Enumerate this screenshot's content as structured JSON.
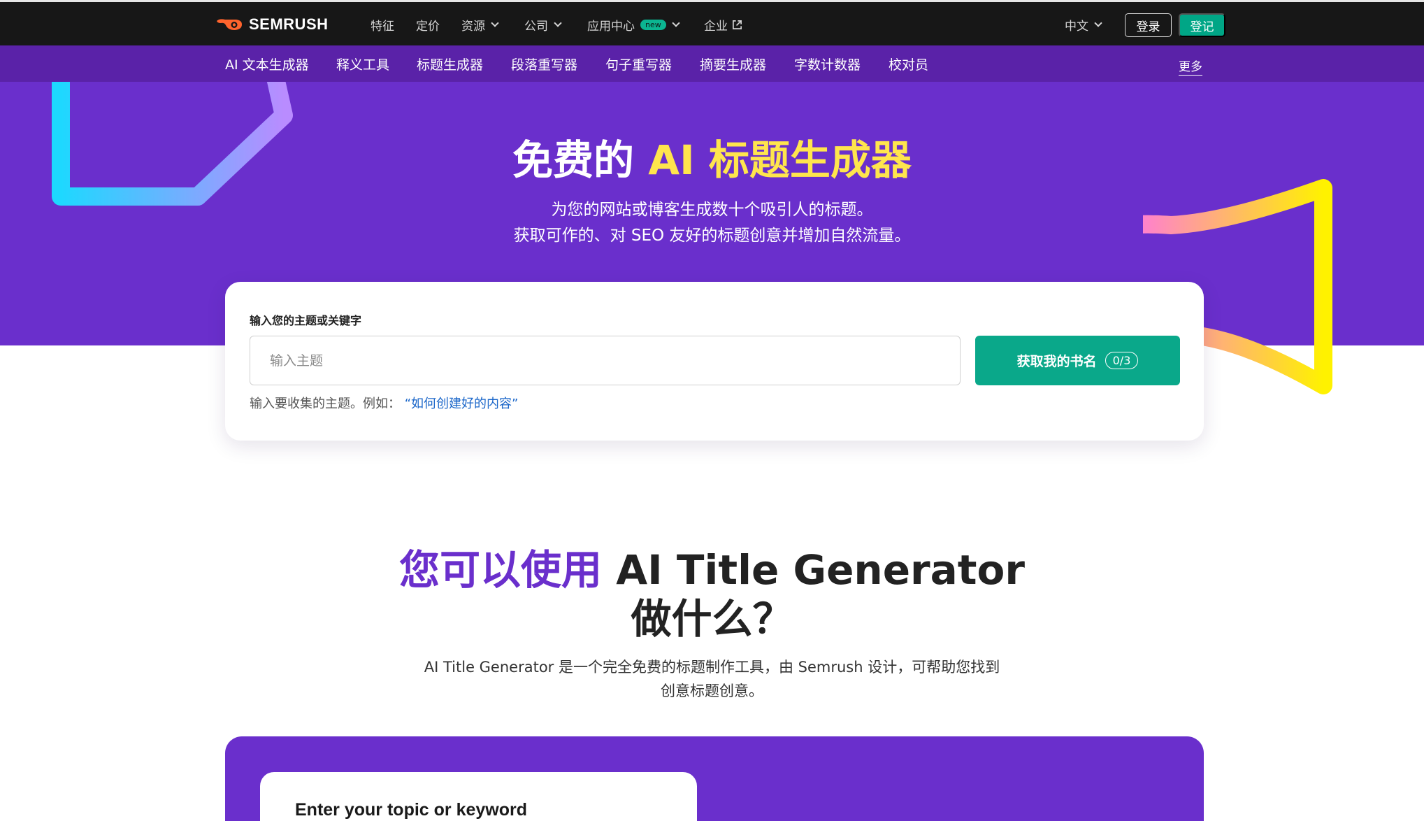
{
  "brand": {
    "name": "SEMRUSH"
  },
  "topnav": {
    "items": [
      {
        "label": "特征"
      },
      {
        "label": "定价"
      },
      {
        "label": "资源"
      },
      {
        "label": "公司"
      },
      {
        "label": "应用中心",
        "badge": "new"
      },
      {
        "label": "企业"
      }
    ],
    "language": "中文",
    "login_label": "登录",
    "signup_label": "登记"
  },
  "subnav": {
    "items": [
      {
        "label": "AI 文本生成器"
      },
      {
        "label": "释义工具"
      },
      {
        "label": "标题生成器"
      },
      {
        "label": "段落重写器"
      },
      {
        "label": "句子重写器"
      },
      {
        "label": "摘要生成器"
      },
      {
        "label": "字数计数器"
      },
      {
        "label": "校对员"
      }
    ],
    "more_label": "更多"
  },
  "hero": {
    "title_prefix": "免费的",
    "title_highlight": "AI 标题生成器",
    "subtitle_line1": "为您的网站或博客生成数十个吸引人的标题。",
    "subtitle_line2": "获取可作的、对 SEO 友好的标题创意并增加自然流量。"
  },
  "form": {
    "label": "输入您的主题或关键字",
    "placeholder": "输入主题",
    "button_label": "获取我的书名",
    "counter": "0/3",
    "hint_prefix": "输入要收集的主题。例如：",
    "hint_example": "“如何创建好的内容”"
  },
  "section": {
    "title_highlight": "您可以使用",
    "title_rest": "AI Title Generator",
    "title_line2": "做什么？",
    "desc_line1": "AI Title Generator 是一个完全免费的标题制作工具，由 Semrush 设计，可帮助您找到",
    "desc_line2": "创意标题创意。"
  },
  "feature": {
    "card_label": "Enter your topic or keyword"
  },
  "colors": {
    "topnav_bg": "#171717",
    "subnav_bg": "#5a22a8",
    "hero_bg": "#6a2fcc",
    "accent_yellow": "#ffe54d",
    "cta_green": "#0aa88a",
    "brand_orange": "#ff642d"
  }
}
